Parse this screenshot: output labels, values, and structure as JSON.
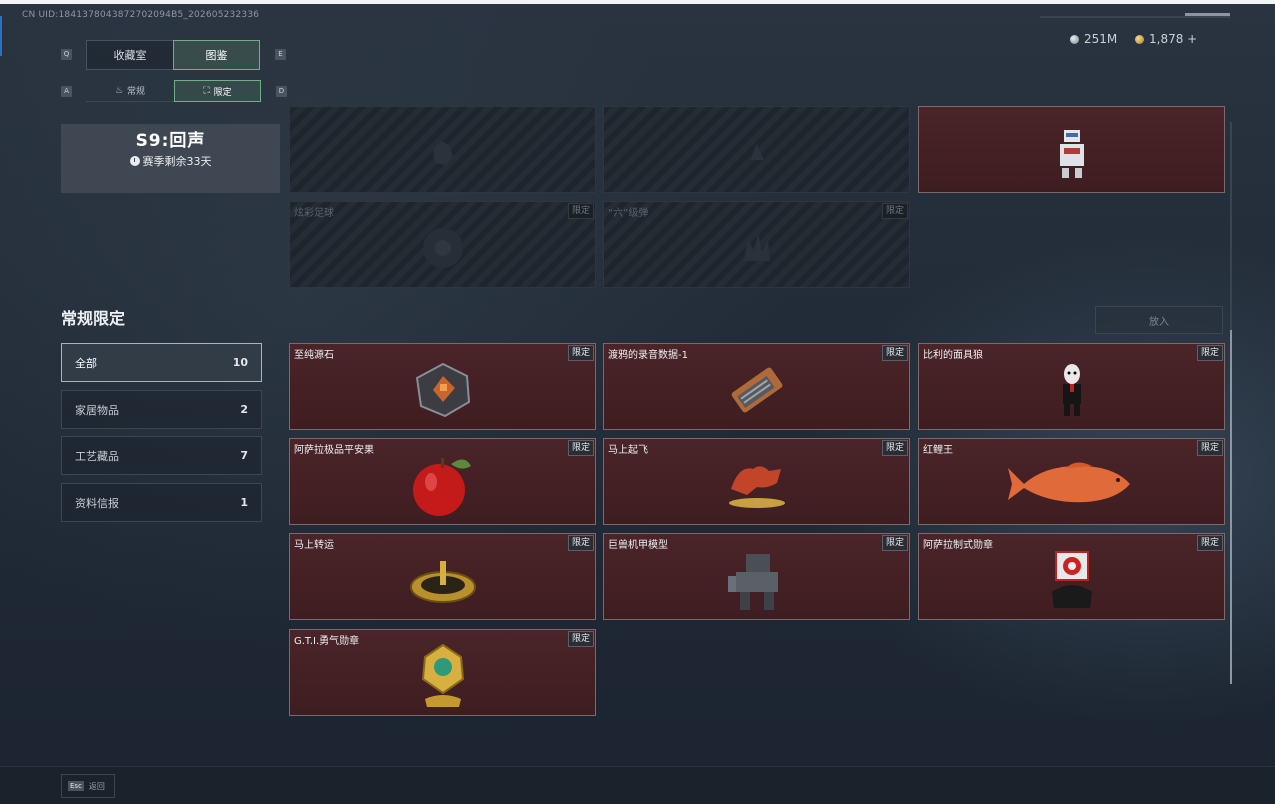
{
  "header": {
    "uid": "CN UID:1841378043872702094B5_202605232336",
    "currency": [
      {
        "icon": "silver-coin-icon",
        "value": "251M",
        "color": "#b9c1c8"
      },
      {
        "icon": "gold-coin-icon",
        "value": "1,878 +",
        "color": "#d9b24c"
      }
    ]
  },
  "tabs": {
    "key_left": "Q",
    "key_right": "E",
    "items": [
      {
        "label": "收藏室",
        "active": false
      },
      {
        "label": "图鉴",
        "active": true
      }
    ]
  },
  "subtabs": {
    "key_left": "A",
    "key_right": "D",
    "items": [
      {
        "label": "常规",
        "icon": "regular-icon",
        "active": false
      },
      {
        "label": "限定",
        "icon": "limited-icon",
        "active": true
      }
    ]
  },
  "season": {
    "title": "S9:回声",
    "remaining": "赛季剩余33天"
  },
  "section": {
    "title": "常规限定",
    "filters": [
      {
        "label": "全部",
        "count": "10",
        "active": true
      },
      {
        "label": "家居物品",
        "count": "2",
        "active": false
      },
      {
        "label": "工艺藏品",
        "count": "7",
        "active": false
      },
      {
        "label": "资料信报",
        "count": "1",
        "active": false
      }
    ]
  },
  "put_button": "放入",
  "tag_label": "限定",
  "season_items": [
    {
      "name": "",
      "locked": true,
      "tag": false,
      "icon": "locked-item-icon"
    },
    {
      "name": "",
      "locked": true,
      "tag": false,
      "icon": "locked-item-icon"
    },
    {
      "name": "",
      "locked": false,
      "tag": false,
      "icon": "robot-figure-icon"
    },
    {
      "name": "炫彩足球",
      "locked": true,
      "tag": true,
      "icon": "football-icon"
    },
    {
      "name": "“六”级弹",
      "locked": true,
      "tag": true,
      "icon": "hand-gesture-icon"
    }
  ],
  "items": [
    {
      "name": "至纯源石",
      "icon": "source-stone-icon"
    },
    {
      "name": "渡鸦的录音数据-1",
      "icon": "data-chip-icon"
    },
    {
      "name": "比利的面具狼",
      "icon": "puppet-figure-icon"
    },
    {
      "name": "阿萨拉极品平安果",
      "icon": "apple-icon"
    },
    {
      "name": "马上起飞",
      "icon": "horse-statue-icon"
    },
    {
      "name": "红鲤王",
      "icon": "carp-fish-icon"
    },
    {
      "name": "马上转运",
      "icon": "compass-disc-icon"
    },
    {
      "name": "巨兽机甲模型",
      "icon": "mech-model-icon"
    },
    {
      "name": "阿萨拉制式勋章",
      "icon": "medal-badge-icon"
    },
    {
      "name": "G.T.I.勇气勋章",
      "icon": "courage-medal-icon"
    }
  ],
  "footer": {
    "key": "Esc",
    "label": "返回"
  }
}
